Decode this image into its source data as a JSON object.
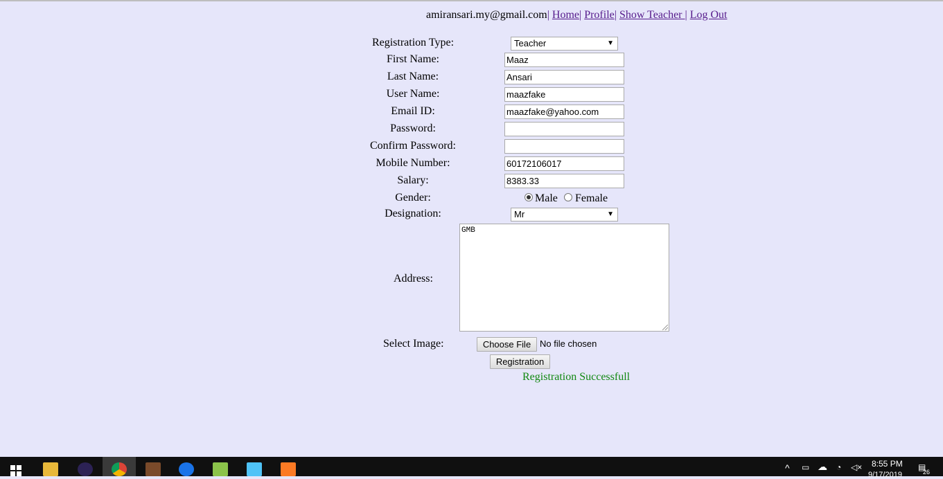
{
  "nav": {
    "email": "amiransari.my@gmail.com",
    "links": [
      "Home",
      "Profile",
      "Show Teacher ",
      "Log Out"
    ],
    "separator": "|"
  },
  "form": {
    "registration_type": {
      "label": "Registration Type:",
      "value": "Teacher"
    },
    "first_name": {
      "label": "First Name:",
      "value": "Maaz"
    },
    "last_name": {
      "label": "Last Name:",
      "value": "Ansari"
    },
    "user_name": {
      "label": "User Name:",
      "value": "maazfake"
    },
    "email": {
      "label": "Email ID:",
      "value": "maazfake@yahoo.com"
    },
    "password": {
      "label": "Password:",
      "value": ""
    },
    "confirm_password": {
      "label": "Confirm Password:",
      "value": ""
    },
    "mobile": {
      "label": "Mobile Number:",
      "value": "60172106017"
    },
    "salary": {
      "label": "Salary:",
      "value": "8383.33"
    },
    "gender": {
      "label": "Gender:",
      "options": [
        "Male",
        "Female"
      ],
      "selected": "Male"
    },
    "designation": {
      "label": "Designation:",
      "value": "Mr"
    },
    "address": {
      "label": "Address:",
      "value": "GMB"
    },
    "image": {
      "label": "Select Image:",
      "button": "Choose File",
      "status": "No file chosen"
    },
    "submit_label": "Registration",
    "message": "Registration Successfull"
  },
  "taskbar": {
    "time": "8:55 PM",
    "date": "9/17/2019",
    "notification_count": "26",
    "accent": "#101010"
  },
  "colors": {
    "background": "#e6e6fa",
    "link": "#551a8b",
    "success": "#118811"
  }
}
